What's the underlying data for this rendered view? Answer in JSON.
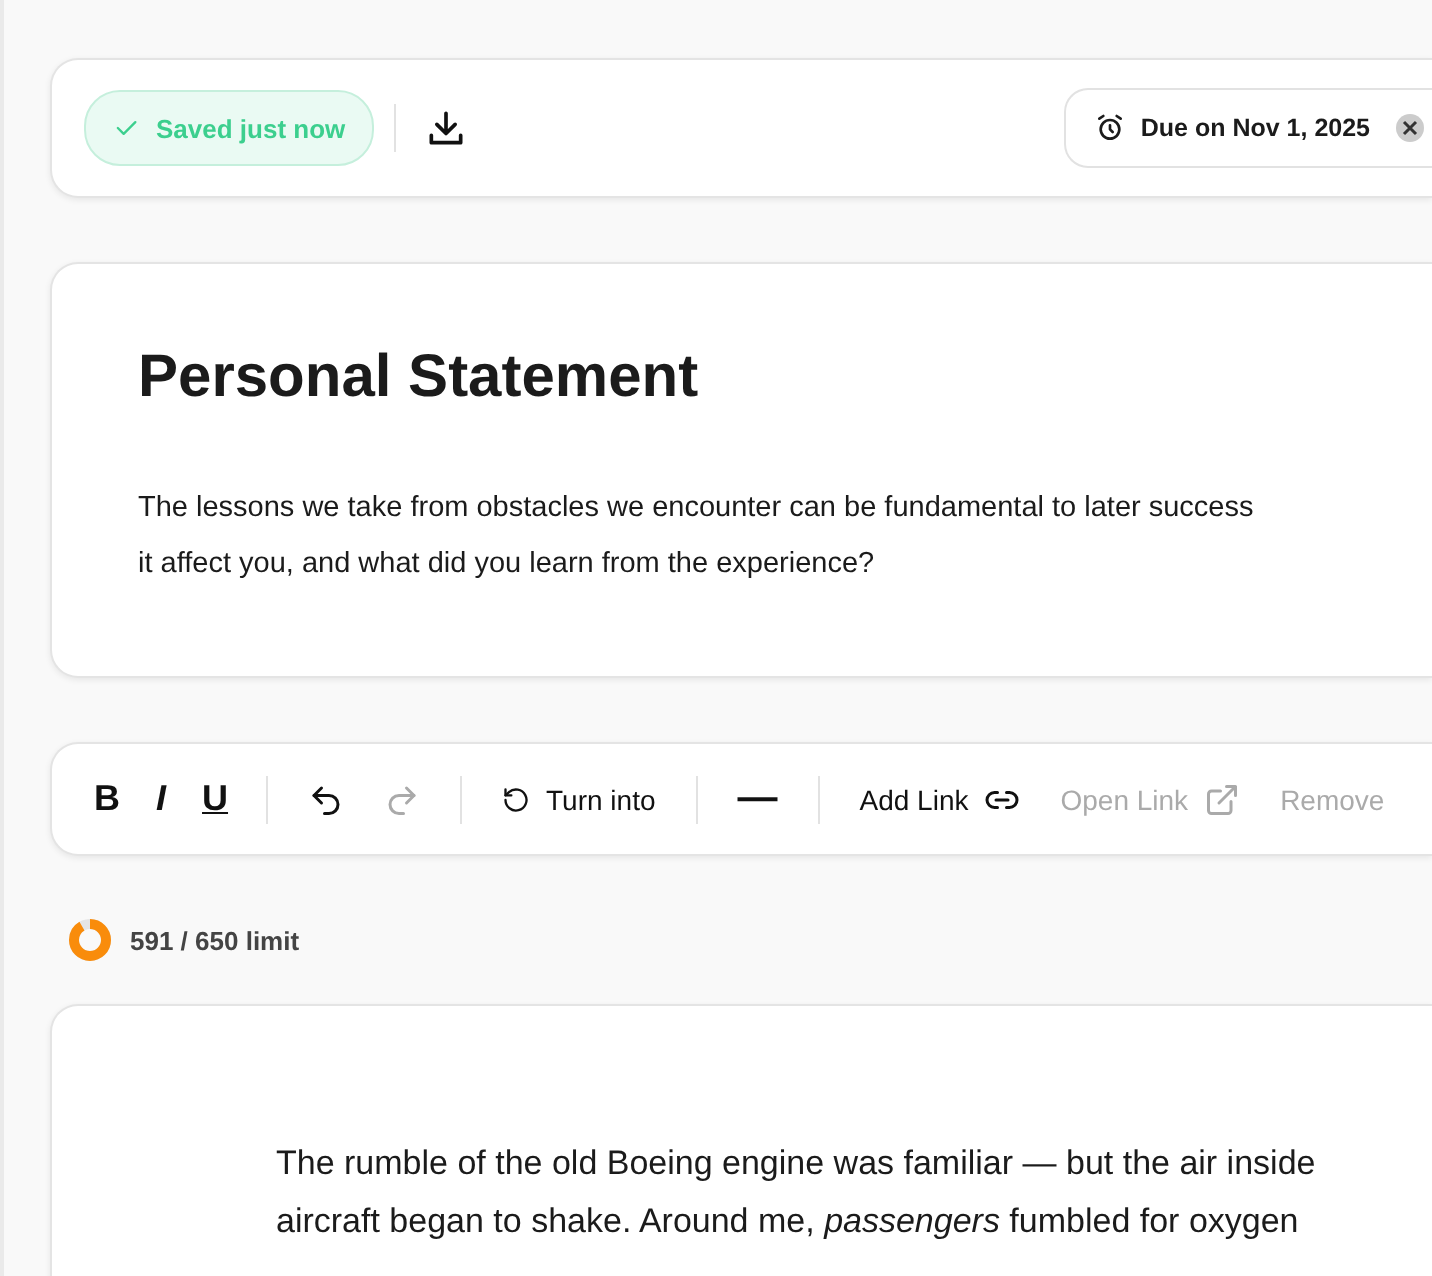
{
  "header": {
    "save_status": "Saved just now",
    "due": "Due on Nov 1, 2025"
  },
  "prompt": {
    "title": "Personal Statement",
    "lines": [
      "The lessons we take from obstacles we encounter can be fundamental to later success",
      "it affect you, and what did you learn from the experience?"
    ]
  },
  "toolbar": [
    {
      "kind": "bold",
      "label": "B",
      "disabled": false
    },
    {
      "kind": "italic",
      "label": "I",
      "disabled": false
    },
    {
      "kind": "underline",
      "label": "U",
      "disabled": false
    },
    {
      "kind": "divider"
    },
    {
      "kind": "undo",
      "disabled": false
    },
    {
      "kind": "redo",
      "disabled": true
    },
    {
      "kind": "divider"
    },
    {
      "kind": "turn",
      "label": "Turn into",
      "disabled": false
    },
    {
      "kind": "divider"
    },
    {
      "kind": "rule",
      "label": "—",
      "disabled": false
    },
    {
      "kind": "divider"
    },
    {
      "kind": "addlink",
      "label": "Add Link",
      "disabled": false
    },
    {
      "kind": "openlink",
      "label": "Open Link",
      "disabled": true
    },
    {
      "kind": "remove",
      "label": "Remove",
      "disabled": true
    }
  ],
  "word_count": {
    "label": "591 / 650 limit",
    "level": 0.91
  },
  "essay": {
    "lines": [
      "The rumble of the old Boeing engine was familiar — but the air inside",
      "aircraft began to shake. Around me, *passengers* fumbled for oxygen"
    ]
  }
}
